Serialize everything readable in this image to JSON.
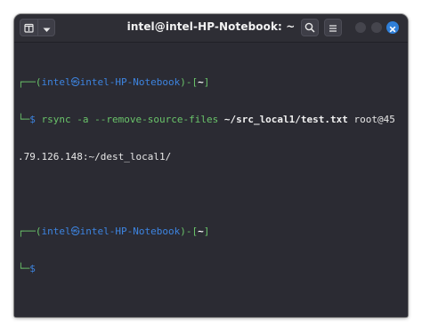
{
  "window": {
    "title": "intel@intel-HP-Notebook: ~"
  },
  "titlebar": {
    "new_tab_icon": "new-tab-icon",
    "dropdown_icon": "chevron-down-icon",
    "search_icon": "search-icon",
    "menu_icon": "hamburger-menu-icon",
    "close_icon": "close-icon",
    "accent_color": "#2f7fd8"
  },
  "terminal": {
    "prompt1": {
      "corner_top": "┌──(",
      "user": "intel",
      "at_symbol": "㉿",
      "host": "intel-HP-Notebook",
      "mid": ")-[",
      "dir": "~",
      "end": "]"
    },
    "command1": {
      "corner_bottom": "└─",
      "dollar": "$",
      "cmd": "rsync",
      "opts": "-a --remove-source-files",
      "src": "~/src_local1/test.txt",
      "dest_part1": "root@45",
      "dest_part2": ".79.126.148:~/dest_local1/"
    },
    "prompt2": {
      "corner_top": "┌──(",
      "user": "intel",
      "at_symbol": "㉿",
      "host": "intel-HP-Notebook",
      "mid": ")-[",
      "dir": "~",
      "end": "]"
    },
    "command2": {
      "corner_bottom": "└─",
      "dollar": "$"
    }
  }
}
